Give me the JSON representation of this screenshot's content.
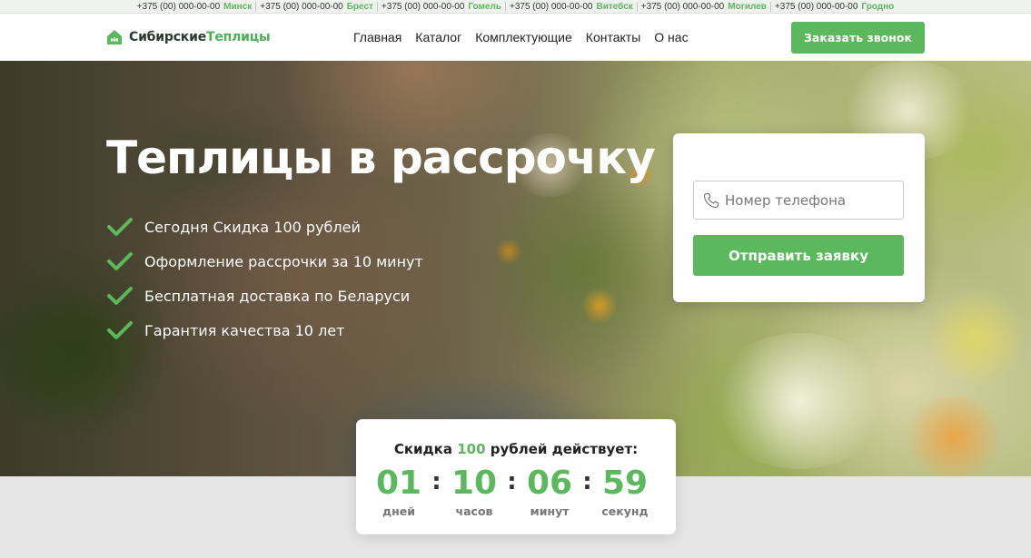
{
  "topbar": {
    "contacts": [
      {
        "phone": "+375 (00) 000-00-00",
        "city": "Минск"
      },
      {
        "phone": "+375 (00) 000-00-00",
        "city": "Брест"
      },
      {
        "phone": "+375 (00) 000-00-00",
        "city": "Гомель"
      },
      {
        "phone": "+375 (00) 000-00-00",
        "city": "Витебск"
      },
      {
        "phone": "+375 (00) 000-00-00",
        "city": "Могилев"
      },
      {
        "phone": "+375 (00) 000-00-00",
        "city": "Гродно"
      }
    ]
  },
  "header": {
    "logo": {
      "icon": "greenhouse-house-icon",
      "part1": "Сибирские",
      "part2": "Теплицы"
    },
    "nav": [
      "Главная",
      "Каталог",
      "Комплектующие",
      "Контакты",
      "О нас"
    ],
    "call_button": "Заказать звонок"
  },
  "hero": {
    "title": "Теплицы в рассрочку",
    "features": [
      "Сегодня Скидка 100 рублей",
      "Оформление рассрочки за 10 минут",
      "Бесплатная доставка по Беларуси",
      "Гарантия качества 10 лет"
    ],
    "feature_icon": "check-icon"
  },
  "form": {
    "phone_placeholder": "Номер телефона",
    "phone_icon": "phone-icon",
    "submit_label": "Отправить заявку"
  },
  "countdown": {
    "title_before": "Скидка ",
    "title_highlight": "100",
    "title_after": " рублей действует:",
    "units": [
      {
        "value": "01",
        "label": "дней"
      },
      {
        "value": "10",
        "label": "часов"
      },
      {
        "value": "06",
        "label": "минут"
      },
      {
        "value": "59",
        "label": "секунд"
      }
    ],
    "separator": ":"
  },
  "colors": {
    "accent": "#5cb85c",
    "dark_text": "#222222",
    "logo_dark": "#2b3a2e"
  }
}
